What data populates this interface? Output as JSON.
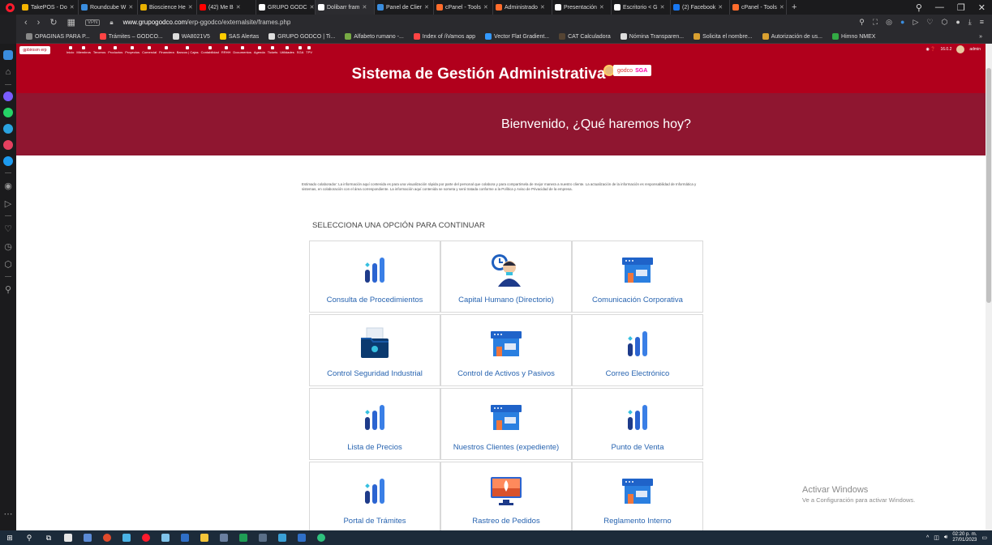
{
  "browser": {
    "tabs": [
      {
        "label": "TakePOS - Do",
        "color": "#f5b400"
      },
      {
        "label": "Roundcube W",
        "color": "#3a8dde"
      },
      {
        "label": "Bioscience He",
        "color": "#e8b000"
      },
      {
        "label": "(42) Me B",
        "color": "#ff0000"
      },
      {
        "label": "GRUPO GODC",
        "color": "#ffffff"
      },
      {
        "label": "Dolibarr fram",
        "color": "#ffffff",
        "active": true
      },
      {
        "label": "Panel de Clier",
        "color": "#3a8dde"
      },
      {
        "label": "cPanel - Tools",
        "color": "#ff6c2c"
      },
      {
        "label": "Administrado",
        "color": "#ff6c2c"
      },
      {
        "label": "Presentación",
        "color": "#ffffff"
      },
      {
        "label": "Escritorio < G",
        "color": "#ffffff"
      },
      {
        "label": "(2) Facebook",
        "color": "#1877f2"
      },
      {
        "label": "cPanel - Tools",
        "color": "#ff6c2c"
      }
    ],
    "new_tab": "+",
    "url_domain": "www.grupogodco.com",
    "url_path": "/erp-ggodco/externalsite/frames.php",
    "vpn": "VPN",
    "bookmarks": [
      {
        "label": "OPAGINAS PARA P...",
        "color": "#888888"
      },
      {
        "label": "Trámites – GODCO...",
        "color": "#ff4444"
      },
      {
        "label": "WA8021V5",
        "color": "#dddddd"
      },
      {
        "label": "SAS Alertas",
        "color": "#ffcc00"
      },
      {
        "label": "GRUPO GODCO | Ti...",
        "color": "#dddddd"
      },
      {
        "label": "Alfabeto rumano -...",
        "color": "#77aa44"
      },
      {
        "label": "Index of /iVamos app",
        "color": "#ff4444"
      },
      {
        "label": "Vector Flat Gradient...",
        "color": "#3399ff"
      },
      {
        "label": "CAT Calculadora",
        "color": "#554433"
      },
      {
        "label": "Nómina Transparen...",
        "color": "#dddddd"
      },
      {
        "label": "Solicita el nombre...",
        "color": "#d9a030"
      },
      {
        "label": "Autorización de us...",
        "color": "#d9a030"
      },
      {
        "label": "Himno NMEX",
        "color": "#33aa44"
      }
    ],
    "bookmarks_more": "»"
  },
  "erp": {
    "logo": "gpbirosm erp",
    "menu": [
      "Inicio",
      "Miembros",
      "Terceros",
      "Productos",
      "Proyectos",
      "Comercial",
      "Financiera",
      "Bancos | Cajas",
      "Contabilidad",
      "RRHH",
      "Documentos",
      "Agenda",
      "Tickets",
      "Utilidades",
      "SGA",
      "TPV"
    ],
    "version": "16.0.2",
    "user": "admin"
  },
  "page": {
    "title": "Sistema de Gestión Administrativa",
    "logo_text": "godco",
    "logo_sga": "SGA",
    "welcome": "Bienvenido, ¿Qué haremos hoy?",
    "notice": "Estimado colaborador: La información aquí contenida es para una visualización rápida por parte del personal que colabora y para compartirsela de mejor manera a nuestro cliente. La actualización de la información es responsabilidad de Informática y sistemas, en colaboración con el área correspondiente. La información aquí contenida se someta y será tratada conforme a la Política y Aviso de Privacidad de la empresa.",
    "select_label": "SELECCIONA UNA OPCIÓN PARA CONTINUAR",
    "options": [
      {
        "label": "Consulta de Procedimientos",
        "icon": "bar-chart-icon"
      },
      {
        "label": "Capital Humano (Directorio)",
        "icon": "person-clock-icon"
      },
      {
        "label": "Comunicación Corporativa",
        "icon": "store-icon"
      },
      {
        "label": "Control Seguridad Industrial",
        "icon": "folder-icon"
      },
      {
        "label": "Control de Activos y Pasivos",
        "icon": "store-icon"
      },
      {
        "label": "Correo Electrónico",
        "icon": "bar-chart-icon"
      },
      {
        "label": "Lista de Precios",
        "icon": "bar-chart-icon"
      },
      {
        "label": "Nuestros Clientes (expediente)",
        "icon": "store-icon"
      },
      {
        "label": "Punto de Venta",
        "icon": "bar-chart-icon"
      },
      {
        "label": "Portal de Trámites",
        "icon": "bar-chart-icon"
      },
      {
        "label": "Rastreo de Pedidos",
        "icon": "rocket-monitor-icon"
      },
      {
        "label": "Reglamento Interno",
        "icon": "store-icon"
      }
    ]
  },
  "watermark": {
    "line1": "Activar Windows",
    "line2": "Ve a Configuración para activar Windows."
  },
  "taskbar": {
    "time": "02:20 p. m.",
    "date": "27/01/2023"
  }
}
